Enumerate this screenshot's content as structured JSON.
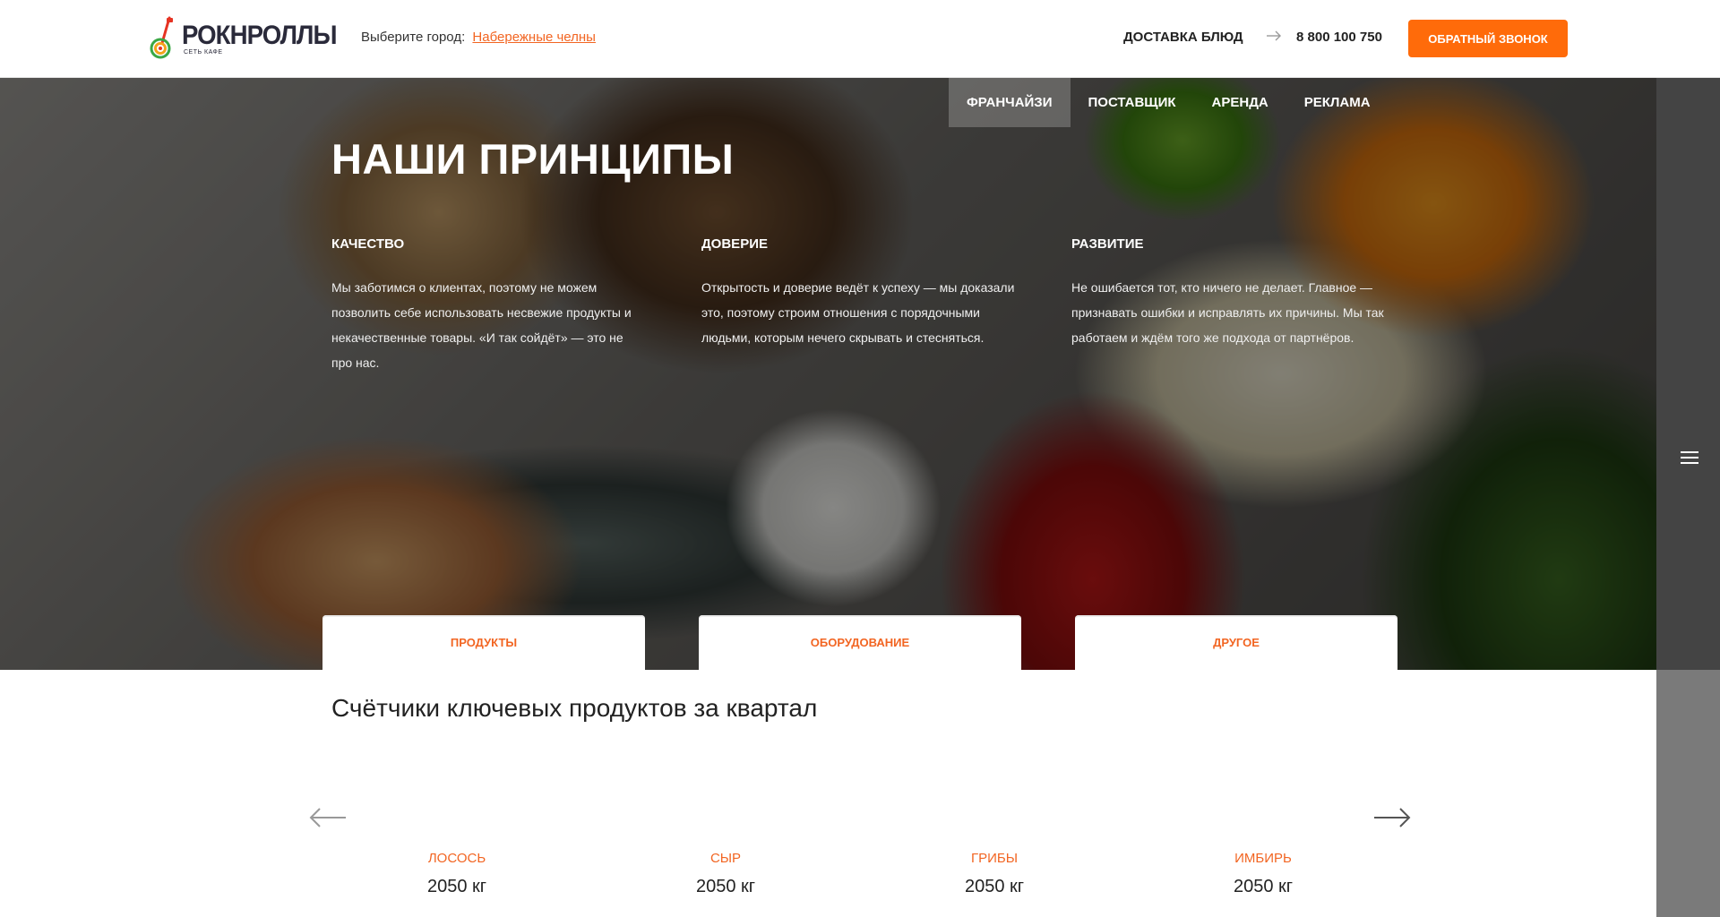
{
  "header": {
    "logo_name": "РОКНРОЛЛЫ",
    "logo_sub": "сеть кафе",
    "city_label": "Выберите город:",
    "city_value": "Набережные челны",
    "delivery_label": "ДОСТАВКА БЛЮД",
    "phone": "8 800 100 750",
    "callback_label": "ОБРАТНЫЙ ЗВОНОК"
  },
  "nav": {
    "items": [
      "ФРАНЧАЙЗИ",
      "ПОСТАВЩИК",
      "АРЕНДА",
      "РЕКЛАМА"
    ],
    "active": "ФРАНЧАЙЗИ"
  },
  "hero": {
    "title": "НАШИ ПРИНЦИПЫ",
    "principles": [
      {
        "title": "КАЧЕСТВО",
        "text": "Мы заботимся о клиентах, поэтому не можем позволить себе использовать несвежие продукты и некачественные товары. «И так сойдёт» — это не про нас."
      },
      {
        "title": "ДОВЕРИЕ",
        "text": "Открытость и доверие ведёт к успеху — мы доказали это, поэтому строим отношения с порядочными людьми, которым нечего скрывать и стесняться."
      },
      {
        "title": "РАЗВИТИЕ",
        "text": "Не ошибается тот, кто ничего не делает. Главное — признавать ошибки и исправлять их причины. Мы так работаем и ждём того же подхода от партнёров."
      }
    ],
    "tabs": [
      "ПРОДУКТЫ",
      "ОБОРУДОВАНИЕ",
      "ДРУГОЕ"
    ]
  },
  "counters": {
    "title": "Счётчики ключевых продуктов за квартал",
    "items": [
      {
        "name": "ЛОСОСЬ",
        "value": "2050 кг"
      },
      {
        "name": "СЫР",
        "value": "2050 кг"
      },
      {
        "name": "ГРИБЫ",
        "value": "2050 кг"
      },
      {
        "name": "ИМБИРЬ",
        "value": "2050 кг"
      }
    ]
  },
  "colors": {
    "accent": "#f26522",
    "button": "#ff6b0a",
    "side_panel": "#7a7a7a"
  },
  "icons": {
    "menu": "hamburger-icon",
    "delivery_arrow": "arrow-right-icon",
    "slider_prev": "arrow-left-icon",
    "slider_next": "arrow-right-icon"
  }
}
